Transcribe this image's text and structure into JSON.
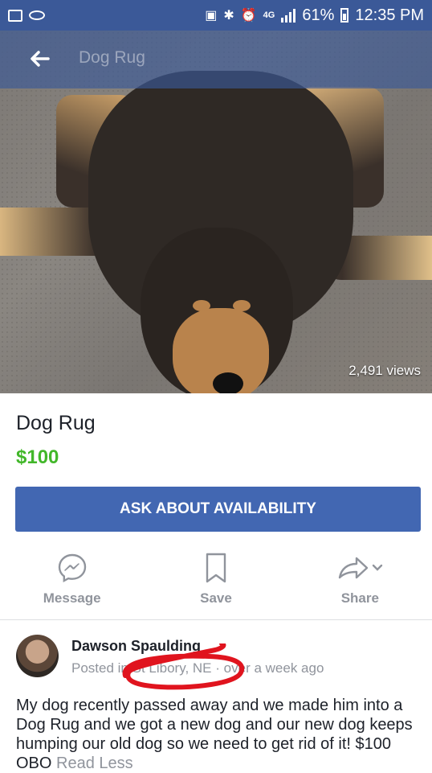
{
  "status_bar": {
    "network": "4G",
    "battery": "61%",
    "time": "12:35 PM"
  },
  "header": {
    "title": "Dog Rug"
  },
  "photo": {
    "views": "2,491 views"
  },
  "listing": {
    "title": "Dog Rug",
    "price": "$100",
    "ask_button": "ASK ABOUT AVAILABILITY"
  },
  "actions": [
    {
      "label": "Message",
      "icon": "messenger-icon"
    },
    {
      "label": "Save",
      "icon": "bookmark-icon"
    },
    {
      "label": "Share",
      "icon": "share-icon"
    }
  ],
  "seller": {
    "name": "Dawson Spaulding",
    "posted_prefix": "Posted in",
    "location": "St Libory, NE",
    "posted_time": "over a week ago"
  },
  "description": {
    "text": "My dog recently passed away and we made him into a Dog Rug and we got a new dog and our new dog keeps humping our old dog so we need to get rid of it! $100 OBO",
    "read_less": "Read Less"
  },
  "colors": {
    "brand": "#3b5998",
    "button": "#4267b2",
    "price": "#42b72a",
    "annotation": "#e0141e"
  }
}
